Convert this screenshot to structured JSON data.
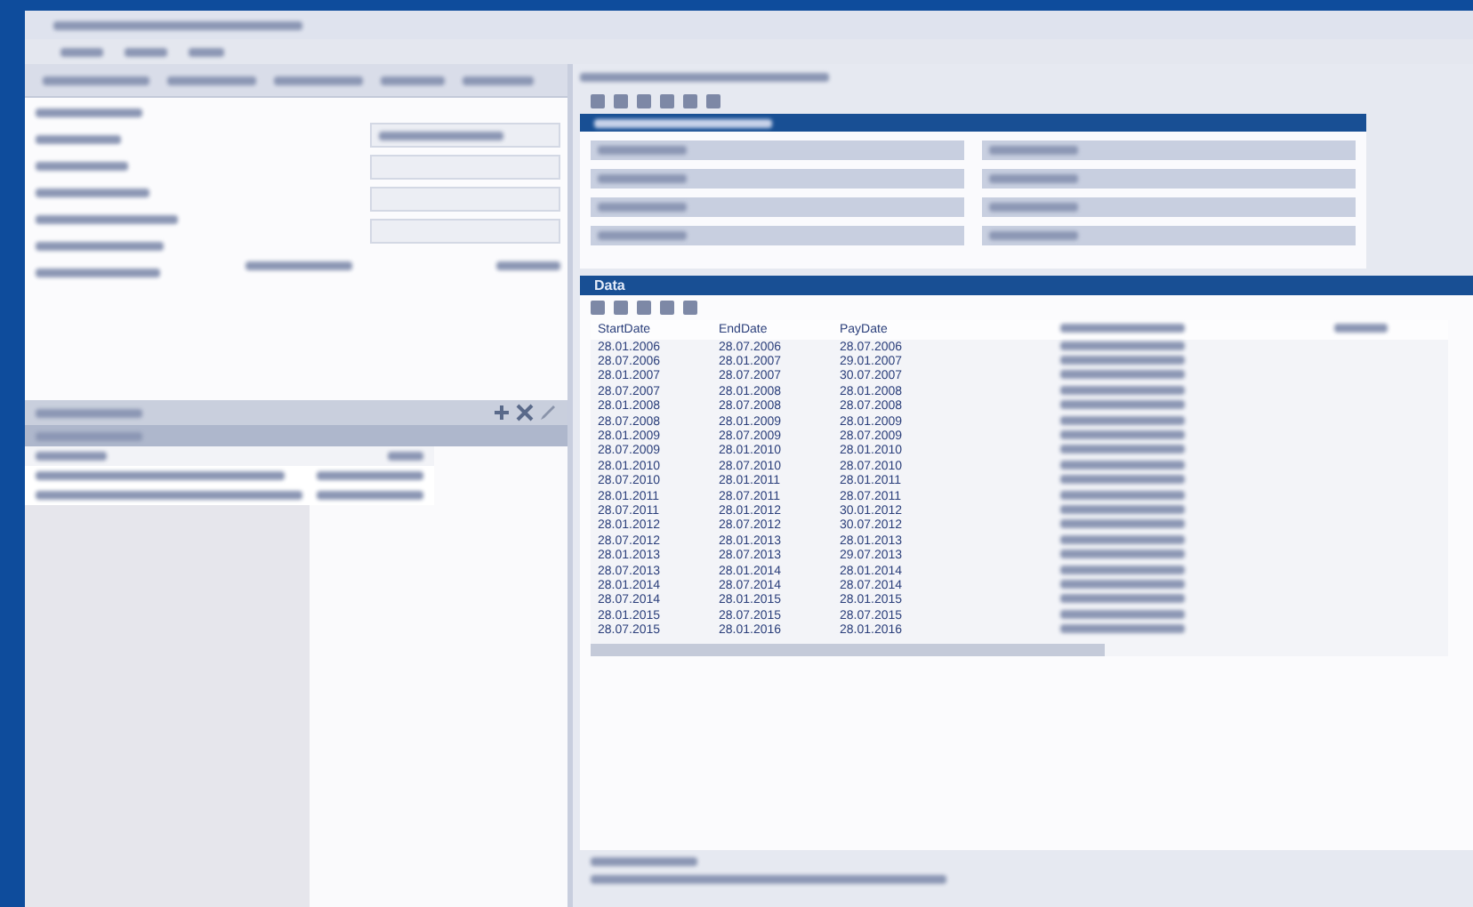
{
  "data_panel": {
    "title": "Data",
    "columns": [
      "StartDate",
      "EndDate",
      "PayDate"
    ],
    "rows": [
      [
        "28.01.2006",
        "28.07.2006",
        "28.07.2006"
      ],
      [
        "28.07.2006",
        "28.01.2007",
        "29.01.2007"
      ],
      [
        "28.01.2007",
        "28.07.2007",
        "30.07.2007"
      ],
      [
        "28.07.2007",
        "28.01.2008",
        "28.01.2008"
      ],
      [
        "28.01.2008",
        "28.07.2008",
        "28.07.2008"
      ],
      [
        "28.07.2008",
        "28.01.2009",
        "28.01.2009"
      ],
      [
        "28.01.2009",
        "28.07.2009",
        "28.07.2009"
      ],
      [
        "28.07.2009",
        "28.01.2010",
        "28.01.2010"
      ],
      [
        "28.01.2010",
        "28.07.2010",
        "28.07.2010"
      ],
      [
        "28.07.2010",
        "28.01.2011",
        "28.01.2011"
      ],
      [
        "28.01.2011",
        "28.07.2011",
        "28.07.2011"
      ],
      [
        "28.07.2011",
        "28.01.2012",
        "30.01.2012"
      ],
      [
        "28.01.2012",
        "28.07.2012",
        "30.07.2012"
      ],
      [
        "28.07.2012",
        "28.01.2013",
        "28.01.2013"
      ],
      [
        "28.01.2013",
        "28.07.2013",
        "29.07.2013"
      ],
      [
        "28.07.2013",
        "28.01.2014",
        "28.01.2014"
      ],
      [
        "28.01.2014",
        "28.07.2014",
        "28.07.2014"
      ],
      [
        "28.07.2014",
        "28.01.2015",
        "28.01.2015"
      ],
      [
        "28.01.2015",
        "28.07.2015",
        "28.07.2015"
      ],
      [
        "28.07.2015",
        "28.01.2016",
        "28.01.2016"
      ]
    ]
  }
}
